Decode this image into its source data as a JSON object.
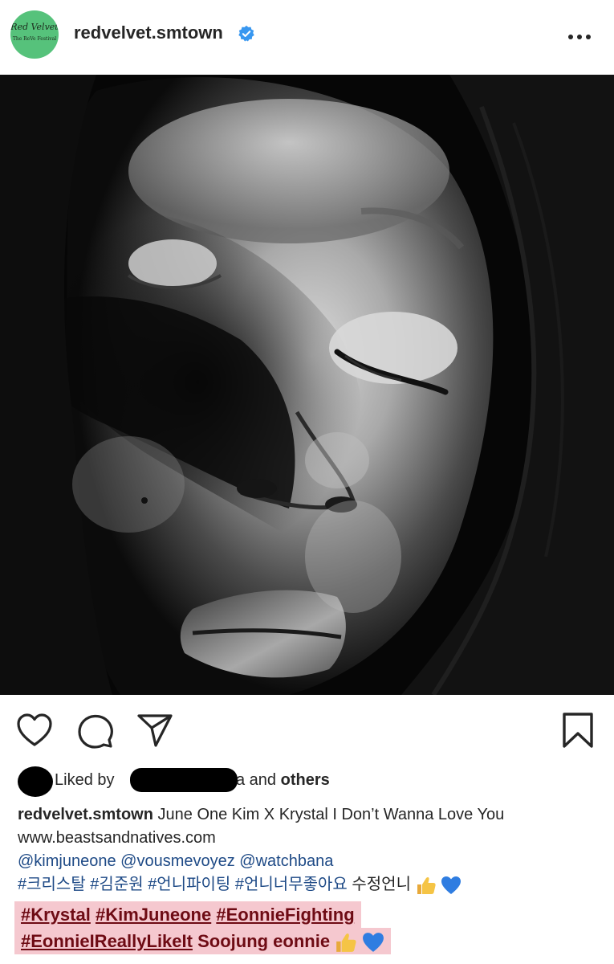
{
  "post": {
    "username": "redvelvet.smtown",
    "avatar_text": "Red Velvet",
    "avatar_subtext": "The ReVe Festival",
    "verified": true,
    "more_menu": "more-options"
  },
  "likes": {
    "prefix": "Liked by",
    "suffix_tail": "a and",
    "others": "others"
  },
  "caption": {
    "author": "redvelvet.smtown",
    "line1_text": "June One Kim X Krystal I Don’t Wanna Love You",
    "line2_link": "www.beastsandnatives.com",
    "line3_mentions": [
      "@kimjuneone",
      "@vousmevoyez",
      "@watchbana"
    ],
    "line4_tags": [
      "#크리스탈",
      "#김준원",
      "#언니파이팅",
      "#언니너무좋아요"
    ],
    "line4_tail": "수정언니"
  },
  "highlight": {
    "line1_tags": [
      "#Krystal",
      "#KimJuneone",
      "#EonnieFighting"
    ],
    "line2_tag": "#EonnieIReallyLikeIt",
    "line2_tail": "Soojung eonnie"
  },
  "icons": {
    "like": "heart-icon",
    "comment": "comment-icon",
    "share": "paper-plane-icon",
    "save": "bookmark-icon",
    "thumbs": "thumbs-up-emoji",
    "heart_blue": "blue-heart-emoji"
  },
  "colors": {
    "verified": "#3897f0",
    "link": "#1e4a86",
    "highlight_bg": "#f5c8cf",
    "highlight_text": "#6e0b14"
  }
}
